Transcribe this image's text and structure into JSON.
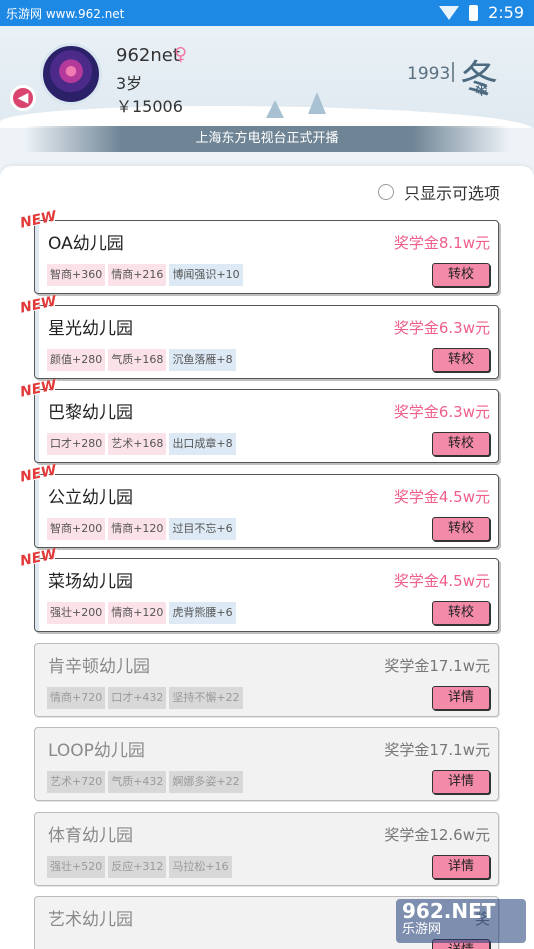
{
  "status": {
    "site": "乐游网 www.962.net",
    "time": "2:59"
  },
  "profile": {
    "name": "962net",
    "age": "3岁",
    "money": "￥15006"
  },
  "header": {
    "year": "1993",
    "season": "冬"
  },
  "news": "上海东方电视台正式开播",
  "filter": {
    "label": "只显示可选项"
  },
  "new_label": "NEW",
  "schools": [
    {
      "name": "OA幼儿园",
      "award": "奖学金8.1w元",
      "tags": [
        "智商+360",
        "情商+216",
        "博闻强识+10"
      ],
      "button": "转校",
      "is_new": true,
      "enabled": true
    },
    {
      "name": "星光幼儿园",
      "award": "奖学金6.3w元",
      "tags": [
        "颜值+280",
        "气质+168",
        "沉鱼落雁+8"
      ],
      "button": "转校",
      "is_new": true,
      "enabled": true
    },
    {
      "name": "巴黎幼儿园",
      "award": "奖学金6.3w元",
      "tags": [
        "口才+280",
        "艺术+168",
        "出口成章+8"
      ],
      "button": "转校",
      "is_new": true,
      "enabled": true
    },
    {
      "name": "公立幼儿园",
      "award": "奖学金4.5w元",
      "tags": [
        "智商+200",
        "情商+120",
        "过目不忘+6"
      ],
      "button": "转校",
      "is_new": true,
      "enabled": true
    },
    {
      "name": "菜场幼儿园",
      "award": "奖学金4.5w元",
      "tags": [
        "强壮+200",
        "情商+120",
        "虎背熊腰+6"
      ],
      "button": "转校",
      "is_new": true,
      "enabled": true
    },
    {
      "name": "肯辛顿幼儿园",
      "award": "奖学金17.1w元",
      "tags": [
        "情商+720",
        "口才+432",
        "坚持不懈+22"
      ],
      "button": "详情",
      "is_new": false,
      "enabled": false
    },
    {
      "name": "LOOP幼儿园",
      "award": "奖学金17.1w元",
      "tags": [
        "艺术+720",
        "气质+432",
        "婀娜多姿+22"
      ],
      "button": "详情",
      "is_new": false,
      "enabled": false
    },
    {
      "name": "体育幼儿园",
      "award": "奖学金12.6w元",
      "tags": [
        "强壮+520",
        "反应+312",
        "马拉松+16"
      ],
      "button": "详情",
      "is_new": false,
      "enabled": false
    },
    {
      "name": "艺术幼儿园",
      "award": "奖",
      "tags": [],
      "button": "详情",
      "is_new": false,
      "enabled": false
    }
  ],
  "watermark": {
    "brand": "962.NET",
    "sub": "乐游网"
  }
}
